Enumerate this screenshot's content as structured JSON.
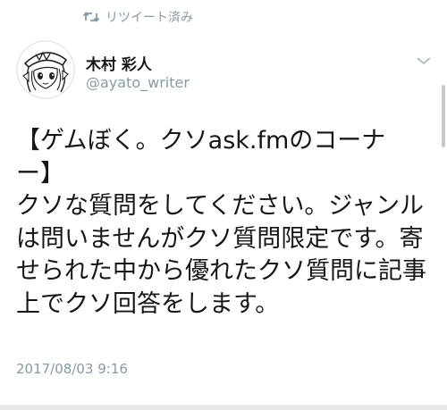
{
  "retweet": {
    "label": "リツイート済み",
    "icon": "retweet-icon"
  },
  "author": {
    "name": "木村 彩人",
    "handle": "@ayato_writer",
    "avatar_icon": "anime-character-avatar"
  },
  "menu": {
    "icon": "chevron-down-icon"
  },
  "tweet": {
    "text": "【ゲムぼく。クソask.fmのコーナー】\nクソな質問をしてください。ジャンルは問いませんがクソ質問限定です。寄せられた中から優れたクソ質問に記事上でクソ回答をします。",
    "timestamp": "2017/08/03 9:16"
  },
  "colors": {
    "text": "#14171a",
    "muted": "#8899a6",
    "background": "#ffffff"
  }
}
